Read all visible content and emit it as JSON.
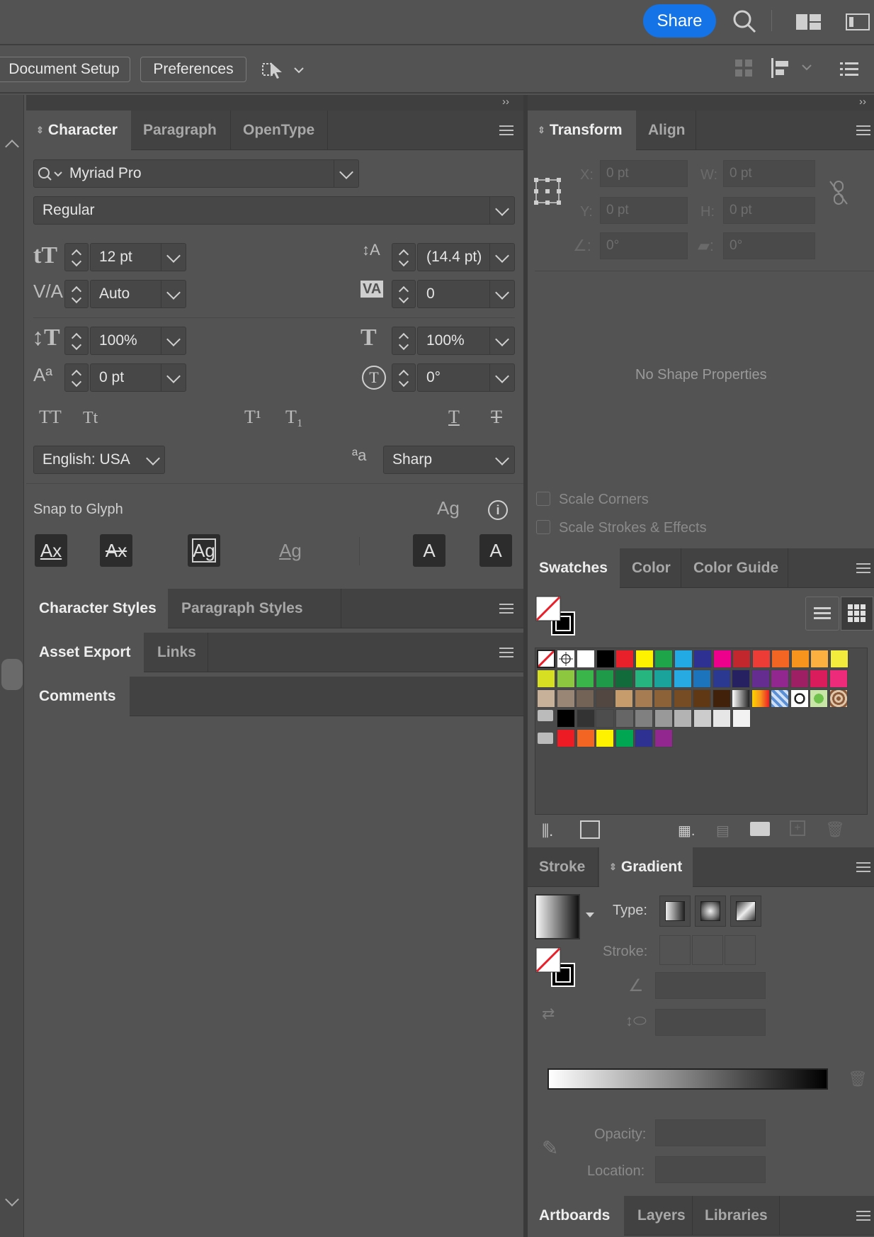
{
  "topbar": {
    "share_label": "Share"
  },
  "control_bar": {
    "document_setup_label": "Document Setup",
    "preferences_label": "Preferences"
  },
  "character_panel": {
    "tabs": [
      "Character",
      "Paragraph",
      "OpenType"
    ],
    "font_family": "Myriad Pro",
    "font_style": "Regular",
    "font_size": "12 pt",
    "leading": "(14.4 pt)",
    "kerning": "Auto",
    "tracking": "0",
    "vertical_scale": "100%",
    "horizontal_scale": "100%",
    "baseline_shift": "0 pt",
    "rotation": "0°",
    "language": "English: USA",
    "antialiasing": "Sharp",
    "snap_to_glyph": "Snap to Glyph",
    "glyph_buttons": [
      "Ax",
      "Ax",
      "Ag",
      "Ag",
      "A",
      "A"
    ]
  },
  "styles_panel": {
    "tabs": [
      "Character Styles",
      "Paragraph Styles"
    ]
  },
  "export_panel": {
    "tabs": [
      "Asset Export",
      "Links"
    ]
  },
  "comments_panel": {
    "tabs": [
      "Comments"
    ]
  },
  "transform_panel": {
    "tabs": [
      "Transform",
      "Align"
    ],
    "x_label": "X:",
    "x_value": "0 pt",
    "y_label": "Y:",
    "y_value": "0 pt",
    "w_label": "W:",
    "w_value": "0 pt",
    "h_label": "H:",
    "h_value": "0 pt",
    "angle_value": "0°",
    "shear_value": "0°",
    "empty_message": "No Shape Properties",
    "scale_corners": "Scale Corners",
    "scale_strokes": "Scale Strokes & Effects"
  },
  "swatches_panel": {
    "tabs": [
      "Swatches",
      "Color",
      "Color Guide"
    ],
    "rows": [
      [
        "#ffffff",
        "#000000",
        "#e8202a",
        "#fff200",
        "#1ea54a",
        "#21aae4",
        "#2e3192",
        "#ec008c",
        "#c1272d",
        "#ed3b35",
        "#f26522",
        "#f7941d",
        "#fbb040",
        "#f4ec3c"
      ],
      [
        "#d7df23",
        "#8dc63f",
        "#39b54a",
        "#1f9a48",
        "#126b3a",
        "#26b57f",
        "#1aa39b",
        "#27aae1",
        "#1c75bc",
        "#2b3990",
        "#262262",
        "#662d91",
        "#92278f",
        "#9e1f63",
        "#da1c5c",
        "#ee2a7b"
      ],
      [
        "#c7b299",
        "#998675",
        "#736357",
        "#534741",
        "#c69c6d",
        "#a67c52",
        "#8c6239",
        "#754c24",
        "#603813",
        "#42210b",
        "grad",
        "orange",
        "pattern",
        "pattern2",
        "green",
        "brown"
      ],
      [
        "#000000",
        "#333333",
        "#4d4d4d",
        "#666666",
        "#808080",
        "#999999",
        "#b3b3b3",
        "#cccccc",
        "#e6e6e6",
        "#f2f2f2"
      ],
      [
        "#ed1c24",
        "#f26522",
        "#fff200",
        "#00a651",
        "#2e3192",
        "#92278f"
      ]
    ]
  },
  "gradient_panel": {
    "tabs": [
      "Stroke",
      "Gradient"
    ],
    "type_label": "Type:",
    "stroke_label": "Stroke:",
    "opacity_label": "Opacity:",
    "location_label": "Location:"
  },
  "bottom_panel": {
    "tabs": [
      "Artboards",
      "Layers",
      "Libraries"
    ]
  }
}
